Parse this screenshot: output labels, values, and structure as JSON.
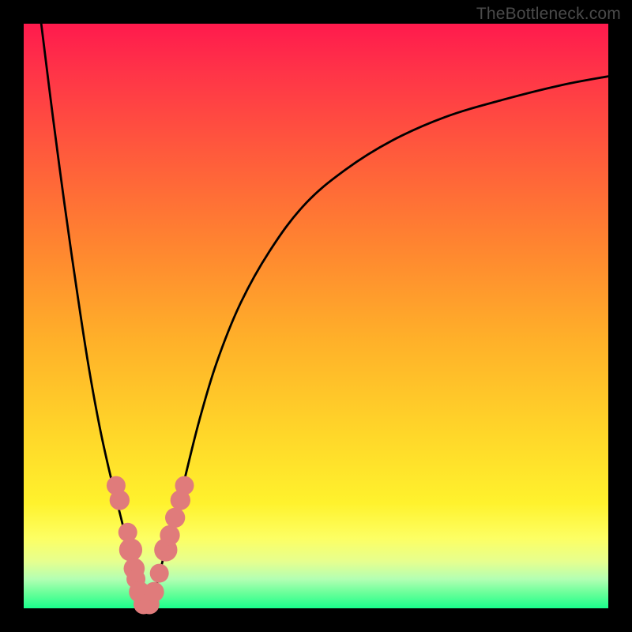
{
  "watermark": "TheBottleneck.com",
  "colors": {
    "frame": "#000000",
    "gradient_top": "#ff1a4d",
    "gradient_bottom": "#1aff8c",
    "curve": "#000000",
    "dots": "#e07b7b"
  },
  "chart_data": {
    "type": "line",
    "title": "",
    "xlabel": "",
    "ylabel": "",
    "xlim": [
      0,
      100
    ],
    "ylim": [
      0,
      100
    ],
    "series": [
      {
        "name": "left-branch",
        "x": [
          3,
          5,
          7,
          9,
          11,
          13,
          15,
          17,
          18,
          19,
          20,
          20.8
        ],
        "y": [
          100,
          84,
          69,
          55,
          42,
          31,
          22,
          14,
          9,
          5,
          2,
          0
        ]
      },
      {
        "name": "right-branch",
        "x": [
          21.2,
          22,
          23,
          24,
          25.5,
          27.5,
          30,
          33,
          37,
          42,
          48,
          55,
          63,
          72,
          82,
          92,
          100
        ],
        "y": [
          0,
          2,
          5,
          9,
          14,
          22,
          32,
          42,
          52,
          61,
          69,
          75,
          80,
          84,
          87,
          89.5,
          91
        ]
      }
    ],
    "scatter_points": {
      "name": "highlighted-points",
      "points": [
        {
          "x": 15.8,
          "y": 21.0,
          "r": 1.2
        },
        {
          "x": 16.4,
          "y": 18.5,
          "r": 1.3
        },
        {
          "x": 17.8,
          "y": 13.0,
          "r": 1.2
        },
        {
          "x": 18.3,
          "y": 10.0,
          "r": 1.6
        },
        {
          "x": 18.9,
          "y": 6.8,
          "r": 1.4
        },
        {
          "x": 19.2,
          "y": 5.0,
          "r": 1.2
        },
        {
          "x": 19.8,
          "y": 2.8,
          "r": 1.4
        },
        {
          "x": 20.5,
          "y": 0.7,
          "r": 1.3
        },
        {
          "x": 21.5,
          "y": 0.7,
          "r": 1.3
        },
        {
          "x": 22.3,
          "y": 2.8,
          "r": 1.3
        },
        {
          "x": 23.2,
          "y": 6.0,
          "r": 1.2
        },
        {
          "x": 24.3,
          "y": 10.0,
          "r": 1.6
        },
        {
          "x": 25.0,
          "y": 12.5,
          "r": 1.3
        },
        {
          "x": 25.9,
          "y": 15.5,
          "r": 1.3
        },
        {
          "x": 26.8,
          "y": 18.5,
          "r": 1.3
        },
        {
          "x": 27.5,
          "y": 21.0,
          "r": 1.2
        }
      ]
    }
  }
}
